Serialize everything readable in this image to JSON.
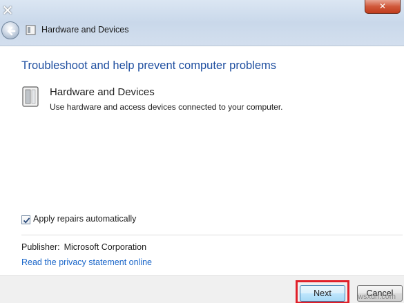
{
  "window": {
    "close_glyph": "✕",
    "close_button_glyph": "✕"
  },
  "nav": {
    "title": "Hardware and Devices",
    "back_icon": "back-arrow-icon",
    "page_icon": "hardware-icon"
  },
  "main": {
    "heading": "Troubleshoot and help prevent computer problems",
    "item": {
      "title": "Hardware and Devices",
      "description": "Use hardware and access devices connected to your computer.",
      "icon": "hardware-devices-icon"
    },
    "apply_repairs": {
      "label": "Apply repairs automatically",
      "checked": true
    },
    "publisher": {
      "label": "Publisher:",
      "value": "Microsoft Corporation"
    },
    "privacy_link": "Read the privacy statement online"
  },
  "footer": {
    "next_label": "Next",
    "cancel_label": "Cancel"
  },
  "colors": {
    "heading": "#1f4fa0",
    "link": "#1a66c9",
    "highlight": "#e0202a"
  },
  "watermark": "wsxdn.com"
}
